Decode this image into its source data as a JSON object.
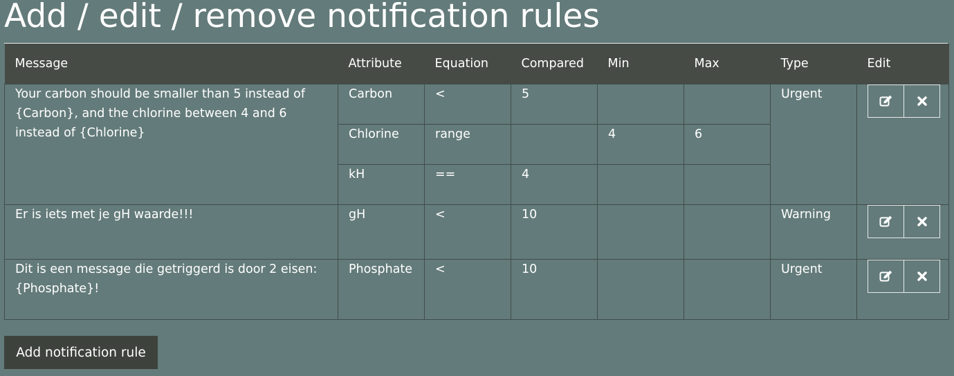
{
  "page": {
    "title": "Add / edit / remove notification rules"
  },
  "table": {
    "headers": {
      "message": "Message",
      "attribute": "Attribute",
      "equation": "Equation",
      "compared": "Compared",
      "min": "Min",
      "max": "Max",
      "type": "Type",
      "edit": "Edit"
    },
    "rules": [
      {
        "message": "Your carbon should be smaller than 5 instead of {Carbon}, and the chlorine between 4 and 6 instead of {Chlorine}",
        "type": "Urgent",
        "conditions": [
          {
            "attribute": "Carbon",
            "equation": "<",
            "compared": "5",
            "min": "",
            "max": ""
          },
          {
            "attribute": "Chlorine",
            "equation": "range",
            "compared": "",
            "min": "4",
            "max": "6"
          },
          {
            "attribute": "kH",
            "equation": "==",
            "compared": "4",
            "min": "",
            "max": ""
          }
        ]
      },
      {
        "message": "Er is iets met je gH waarde!!!",
        "type": "Warning",
        "conditions": [
          {
            "attribute": "gH",
            "equation": "<",
            "compared": "10",
            "min": "",
            "max": ""
          }
        ]
      },
      {
        "message": "Dit is een message die getriggerd is door 2 eisen: {Phosphate}!",
        "type": "Urgent",
        "conditions": [
          {
            "attribute": "Phosphate",
            "equation": "<",
            "compared": "10",
            "min": "",
            "max": ""
          }
        ]
      }
    ]
  },
  "actions": {
    "add_label": "Add notification rule"
  },
  "icons": {
    "edit": "edit-icon",
    "remove": "close-icon"
  },
  "colors": {
    "background": "#637b7a",
    "header": "#464b45",
    "button": "#3d423c",
    "text": "#ffffff"
  }
}
